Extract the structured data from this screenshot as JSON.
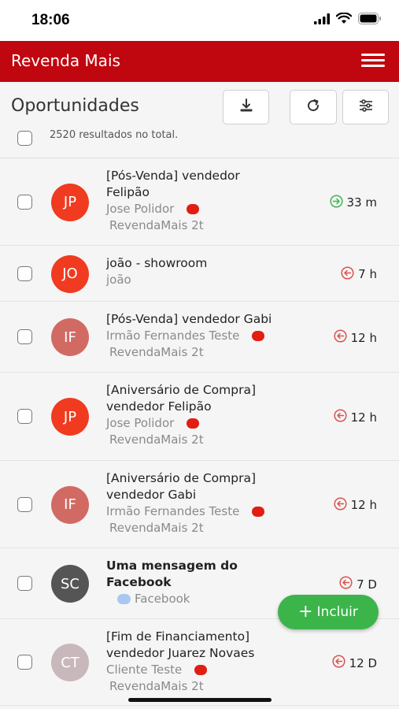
{
  "status_bar": {
    "time": "18:06"
  },
  "header": {
    "app_title": "Revenda Mais"
  },
  "toolbar": {
    "title": "Oportunidades",
    "results": "2520 resultados no total."
  },
  "colors": {
    "brand_red": "#c0060f",
    "fab_green": "#3bb54a",
    "dot_red": "#e21d12",
    "incoming_green": "#3bb54a",
    "outgoing_red": "#d9534f"
  },
  "items": [
    {
      "initials": "JP",
      "avatar_color": "#f03b20",
      "title_lines": [
        "[Pós-Venda] vendedor",
        "Felipão"
      ],
      "bold": false,
      "contact": "Jose Polidor",
      "dot": "red",
      "store": "RevendaMais 2t",
      "time": "33 m",
      "direction_icon": "arrow-right-circle-icon",
      "direction_color": "#3bb54a"
    },
    {
      "initials": "JO",
      "avatar_color": "#f03b20",
      "title_lines": [
        "joão - showroom"
      ],
      "bold": false,
      "contact": "joão",
      "dot": "",
      "store": "",
      "time": "7 h",
      "direction_icon": "arrow-left-circle-icon",
      "direction_color": "#d9534f"
    },
    {
      "initials": "IF",
      "avatar_color": "#d26a64",
      "title_lines": [
        "[Pós-Venda] vendedor Gabi"
      ],
      "bold": false,
      "contact": "Irmão Fernandes Teste",
      "dot": "red",
      "store": "RevendaMais 2t",
      "time": "12 h",
      "direction_icon": "arrow-left-circle-icon",
      "direction_color": "#d9534f"
    },
    {
      "initials": "JP",
      "avatar_color": "#f03b20",
      "title_lines": [
        "[Aniversário de Compra]",
        "vendedor Felipão"
      ],
      "bold": false,
      "contact": "Jose Polidor",
      "dot": "red",
      "store": "RevendaMais 2t",
      "time": "12 h",
      "direction_icon": "arrow-left-circle-icon",
      "direction_color": "#d9534f"
    },
    {
      "initials": "IF",
      "avatar_color": "#d26a64",
      "title_lines": [
        "[Aniversário de Compra]",
        "vendedor Gabi"
      ],
      "bold": false,
      "contact": "Irmão Fernandes Teste",
      "dot": "red",
      "store": "RevendaMais 2t",
      "time": "12 h",
      "direction_icon": "arrow-left-circle-icon",
      "direction_color": "#d9534f"
    },
    {
      "initials": "SC",
      "avatar_color": "#555555",
      "title_lines": [
        "Uma mensagem do",
        "Facebook"
      ],
      "bold": true,
      "contact": "Facebook",
      "dot": "blue",
      "store": "",
      "time": "7 D",
      "direction_icon": "arrow-left-circle-icon",
      "direction_color": "#d9534f"
    },
    {
      "initials": "CT",
      "avatar_color": "#c8b8bc",
      "title_lines": [
        "[Fim de Financiamento]",
        "vendedor Juarez Novaes"
      ],
      "bold": false,
      "contact": "Cliente Teste",
      "dot": "red",
      "store": "RevendaMais 2t",
      "time": "12 D",
      "direction_icon": "arrow-left-circle-icon",
      "direction_color": "#d9534f"
    }
  ],
  "fab": {
    "label": "Incluir"
  }
}
